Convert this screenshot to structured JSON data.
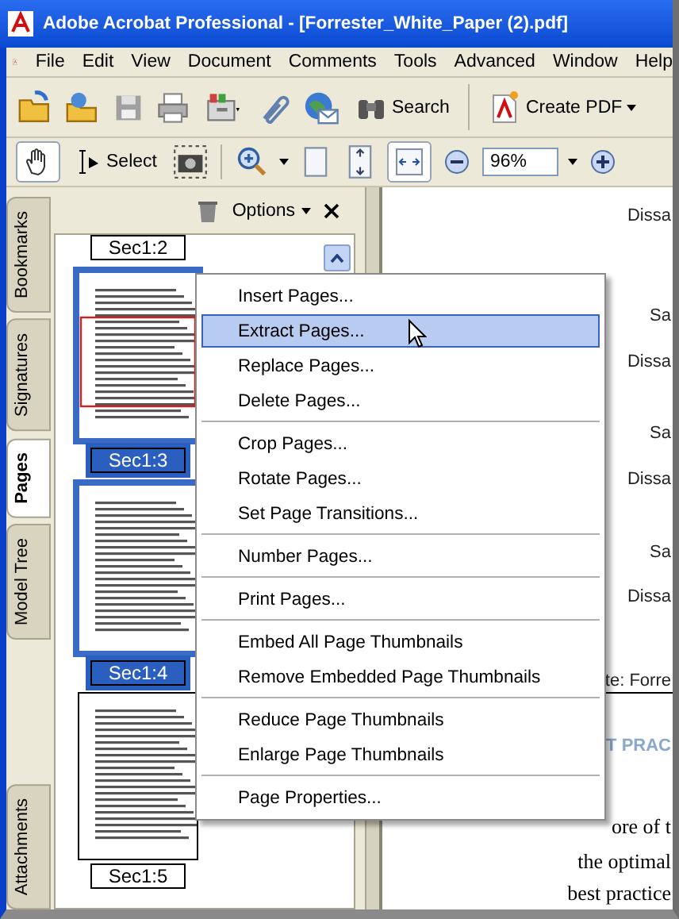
{
  "window": {
    "title": "Adobe Acrobat Professional - [Forrester_White_Paper (2).pdf]"
  },
  "menu_bar": [
    "File",
    "Edit",
    "View",
    "Document",
    "Comments",
    "Tools",
    "Advanced",
    "Window",
    "Help"
  ],
  "toolbar_1": {
    "search": "Search",
    "create_pdf": "Create PDF"
  },
  "toolbar_2": {
    "hand_selected": true,
    "select_label": "Select",
    "select_selected": false,
    "fit_width_selected": true,
    "zoom": "96%"
  },
  "side_tabs": [
    {
      "label": "Bookmarks",
      "selected": false
    },
    {
      "label": "Signatures",
      "selected": false
    },
    {
      "label": "Pages",
      "selected": true
    },
    {
      "label": "Model Tree",
      "selected": false
    },
    {
      "label": "Attachments",
      "selected": false
    }
  ],
  "panel": {
    "options": "Options"
  },
  "thumbnails": [
    {
      "label": "Sec1:2",
      "selected": false
    },
    {
      "label": "Sec1:3",
      "selected": true,
      "current_view": true
    },
    {
      "label": "Sec1:4",
      "selected": true,
      "current_view": false
    },
    {
      "label": "Sec1:5",
      "selected": false,
      "current_view": false
    }
  ],
  "document": [
    {
      "kind": "body",
      "text": "Dissa"
    },
    {
      "kind": "body",
      "text": "Sa"
    },
    {
      "kind": "body",
      "text": "Dissa"
    },
    {
      "kind": "body",
      "text": "Sa"
    },
    {
      "kind": "body",
      "text": "Dissa"
    },
    {
      "kind": "body",
      "text": "Sa"
    },
    {
      "kind": "body",
      "text": "Dissa"
    },
    {
      "kind": "caption",
      "text": "te: Forre"
    },
    {
      "kind": "heading",
      "text": "T PRAC"
    },
    {
      "kind": "serif",
      "text": "ore of t"
    },
    {
      "kind": "serif",
      "text": "the optimal"
    },
    {
      "kind": "serif",
      "text": "best practice"
    }
  ],
  "context_menu": [
    [
      {
        "label": "Insert Pages...",
        "selected": false
      },
      {
        "label": "Extract Pages...",
        "selected": true
      },
      {
        "label": "Replace Pages...",
        "selected": false
      },
      {
        "label": "Delete Pages...",
        "selected": false
      }
    ],
    [
      {
        "label": "Crop Pages...",
        "selected": false
      },
      {
        "label": "Rotate Pages...",
        "selected": false
      },
      {
        "label": "Set Page Transitions...",
        "selected": false
      }
    ],
    [
      {
        "label": "Number Pages...",
        "selected": false
      }
    ],
    [
      {
        "label": "Print Pages...",
        "selected": false
      }
    ],
    [
      {
        "label": "Embed All Page Thumbnails",
        "selected": false
      },
      {
        "label": "Remove Embedded Page Thumbnails",
        "selected": false
      }
    ],
    [
      {
        "label": "Reduce Page Thumbnails",
        "selected": false
      },
      {
        "label": "Enlarge Page Thumbnails",
        "selected": false
      }
    ],
    [
      {
        "label": "Page Properties...",
        "selected": false
      }
    ]
  ]
}
